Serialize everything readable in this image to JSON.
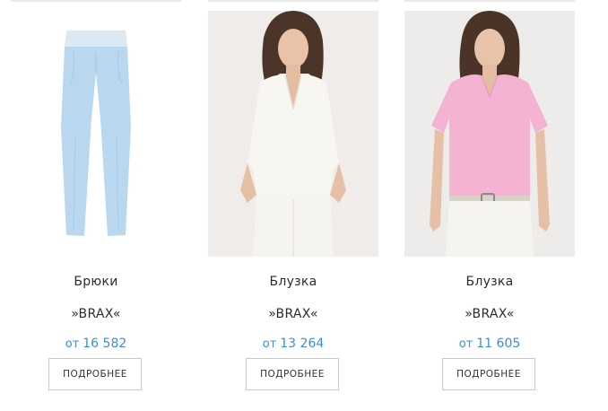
{
  "products": [
    {
      "name": "Брюки",
      "brand": "»BRAX«",
      "price_prefix": "от",
      "price": "16 582",
      "button_label": "ПОДРОБНЕЕ",
      "image": "light-blue-trousers"
    },
    {
      "name": "Блузка",
      "brand": "»BRAX«",
      "price_prefix": "от",
      "price": "13 264",
      "button_label": "ПОДРОБНЕЕ",
      "image": "model-white-blouse"
    },
    {
      "name": "Блузка",
      "brand": "»BRAX«",
      "price_prefix": "от",
      "price": "11 605",
      "button_label": "ПОДРОБНЕЕ",
      "image": "model-pink-blouse"
    }
  ],
  "colors": {
    "price": "#3d8ed8",
    "text": "#2b2b2b",
    "button_border": "#c9c9c9"
  }
}
